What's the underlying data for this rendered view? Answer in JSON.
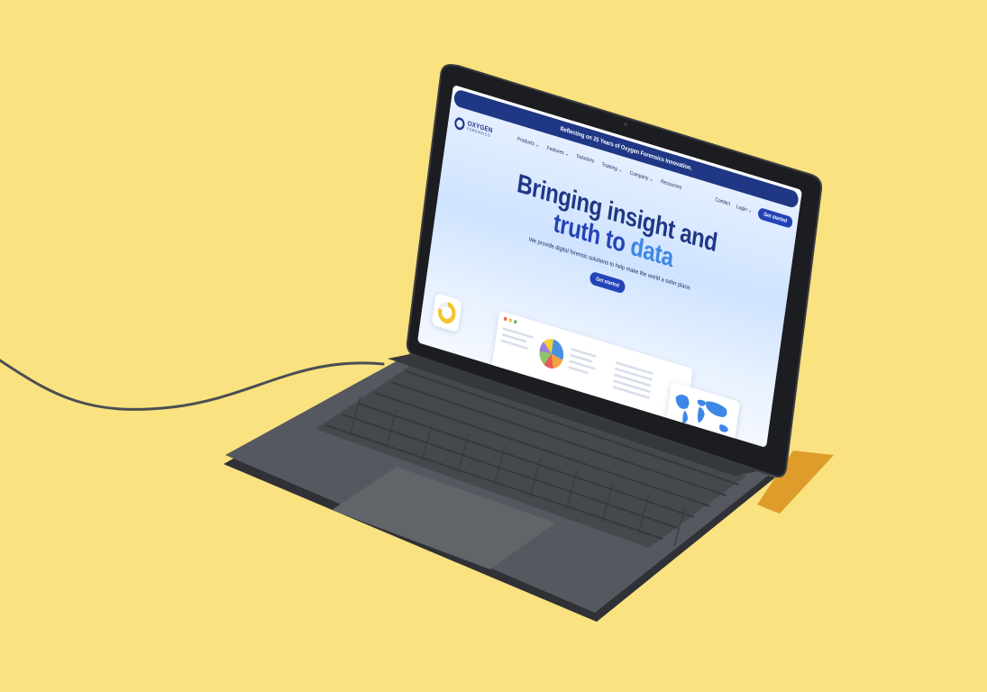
{
  "scene": {
    "background_color": "#F9E27F",
    "laptop_color": "#54575d",
    "accent": "#2343b8",
    "brand_navy": "#1f3785"
  },
  "website": {
    "banner": "Reflecting on 25 Years of Oxygen Forensics Innovation.",
    "logo": {
      "word": "OXYGEN",
      "sub": "FORENSICS"
    },
    "nav": {
      "links": [
        "Products ⌄",
        "Features ⌄",
        "Solutions",
        "Training ⌄",
        "Company ⌄",
        "Resources"
      ],
      "contact": "Contact",
      "login": "Login ⌄",
      "cta": "Get started"
    },
    "hero": {
      "line1": "Bringing insight and",
      "line2_part1": "truth to",
      "line2_part2": "data",
      "subtitle": "We provide digital forensic solutions to help make the world a safer place.",
      "cta": "Get started"
    }
  }
}
